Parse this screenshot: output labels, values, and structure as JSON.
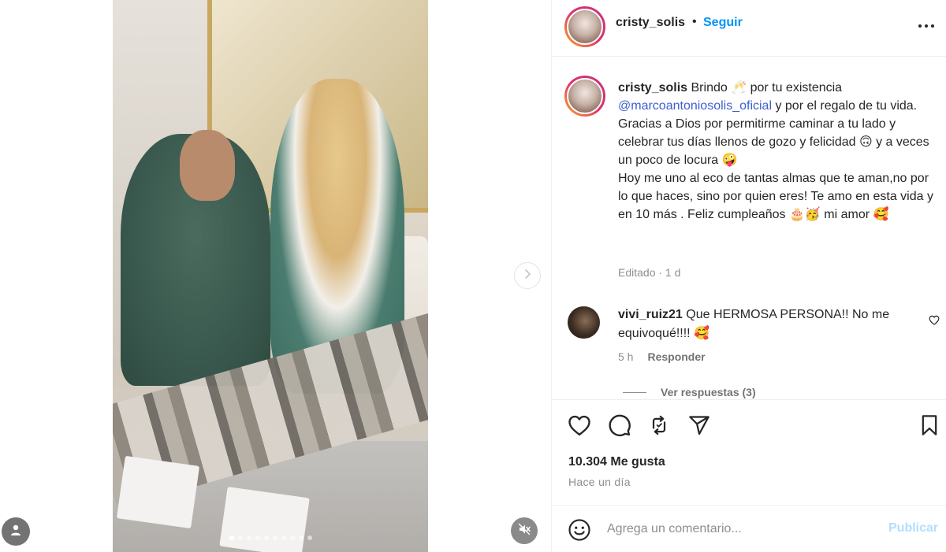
{
  "post": {
    "username": "cristy_solis",
    "separator": "•",
    "follow_label": "Seguir",
    "caption": {
      "username": "cristy_solis",
      "line1": " Brindo 🥂 por tu existencia",
      "mention": "@marcoantoniosolis_oficial",
      "line2": " y por el regalo de tu vida.",
      "body": "Gracias a Dios por permitirme caminar a tu lado y celebrar tus días llenos de gozo y felicidad 🙃 y a veces un poco de locura 🤪\nHoy me uno al eco de tantas almas que te aman,no por lo que haces, sino por quien eres! Te amo en esta vida y en 10 más . Feliz cumpleaños 🎂🥳 mi amor 🥰",
      "meta": "Editado · 1 d"
    },
    "comment": {
      "username": "vivi_ruiz21",
      "text": " Que HERMOSA PERSONA!! No me equivoqué!!!! 🥰",
      "time": "5 h",
      "reply_label": "Responder",
      "view_replies": "Ver respuestas (3)"
    },
    "likes_count": "10.304",
    "likes_label": " Me gusta",
    "time_ago": "Hace un día",
    "comment_input": {
      "placeholder": "Agrega un comentario..."
    },
    "publish_label": "Publicar"
  },
  "carousel": {
    "slide_count": 10,
    "active_slide": 1
  },
  "icons": {
    "more": "more-options-icon",
    "like": "heart-icon",
    "comment": "comment-icon",
    "repost": "repost-icon",
    "share": "share-icon",
    "save": "bookmark-icon",
    "emoji": "emoji-icon",
    "next": "chevron-right-icon",
    "mute": "speaker-muted-icon",
    "tags": "user-tag-icon"
  },
  "colors": {
    "accent": "#0095f6",
    "mention": "#3d5fcf",
    "muted_text": "#8e8e8e",
    "publish_disabled": "#b2dffc"
  }
}
